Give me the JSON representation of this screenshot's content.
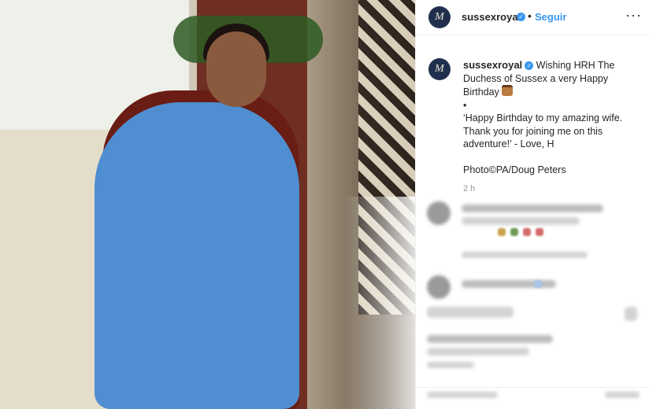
{
  "post": {
    "username": "sussexroyal",
    "follow_label": "Seguir",
    "separator": "•",
    "more_label": "···",
    "avatar_letter": "M",
    "caption_lines": [
      "Wishing HRH The Duchess of Sussex a very Happy Birthday",
      "•",
      "‘Happy Birthday to my amazing wife. Thank you for joining me on this adventure!’ - Love, H",
      "Photo©PA/Doug Peters"
    ],
    "timestamp": "2 h"
  },
  "icons": {
    "verified": "verified-badge-icon",
    "cake": "cake-emoji-icon",
    "more": "more-options-icon"
  },
  "colors": {
    "link_blue": "#3897f0",
    "text": "#262626",
    "muted": "#999999",
    "border": "#efefef"
  }
}
